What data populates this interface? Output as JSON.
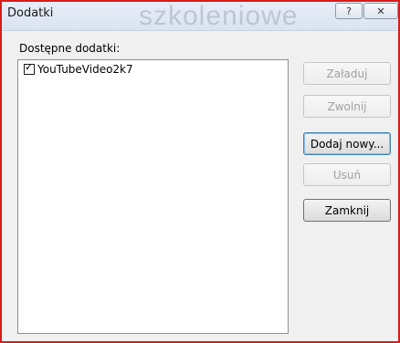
{
  "window": {
    "title": "Dodatki",
    "watermark": "szkoleniowe",
    "help_button": "?",
    "close_button": "✕"
  },
  "addins": {
    "label": "Dostępne dodatki:",
    "items": [
      {
        "name": "YouTubeVideo2k7",
        "checked": true
      }
    ]
  },
  "buttons": {
    "load": "Załaduj",
    "unload": "Zwolnij",
    "add_new": "Dodaj nowy...",
    "remove": "Usuń",
    "close": "Zamknij"
  }
}
